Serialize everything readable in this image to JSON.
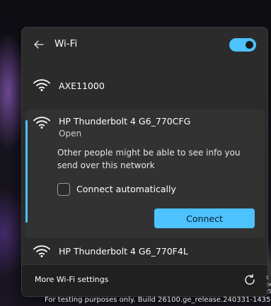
{
  "panel": {
    "title": "Wi-Fi",
    "wifi_enabled": true
  },
  "networks": [
    {
      "name": "AXE11000"
    },
    {
      "name": "HP Thunderbolt 4 G6_770CFG",
      "status": "Open",
      "warning": "Other people might be able to see info you send over this network",
      "connect_automatically_label": "Connect automatically",
      "connect_automatically_checked": false,
      "connect_label": "Connect"
    },
    {
      "name": "HP Thunderbolt 4 G6_770F4L"
    }
  ],
  "footer": {
    "more_settings_label": "More Wi-Fi settings"
  },
  "watermark": "For testing purposes only. Build 26100.ge_release.240331-1435",
  "colors": {
    "accent": "#4cc2ff",
    "flyout_bg": "#2b2b2b",
    "expanded_bg": "#323232",
    "footer_bg": "#202020"
  },
  "icons": {
    "back": "back-arrow-icon",
    "wifi": "wifi-icon",
    "refresh": "refresh-icon"
  }
}
